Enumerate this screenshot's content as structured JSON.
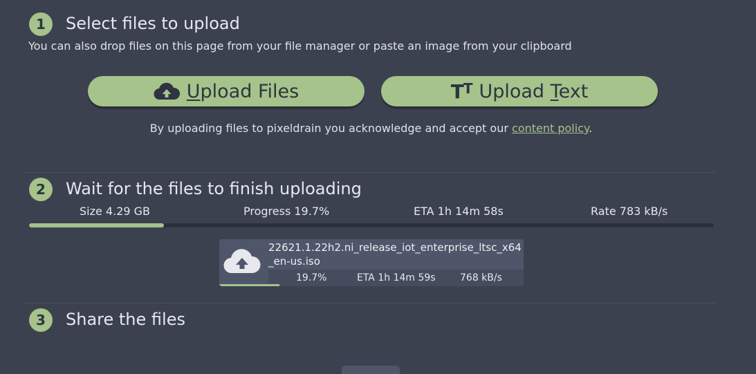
{
  "colors": {
    "background": "#3c4150",
    "accent": "#a5c38a",
    "card": "#4f5669",
    "track": "#2b303c"
  },
  "step1": {
    "number": "1",
    "title": "Select files to upload",
    "subtitle": "You can also drop files on this page from your file manager or paste an image from your clipboard",
    "upload_files": {
      "icon": "cloud-upload-icon",
      "mnemonic": "U",
      "label_rest": "pload Files"
    },
    "upload_text": {
      "icon": "text-size-icon",
      "label_start": "Upload ",
      "mnemonic": "T",
      "label_rest": "ext"
    },
    "policy_prefix": "By uploading files to pixeldrain you acknowledge and accept our ",
    "policy_link": "content policy",
    "policy_suffix": "."
  },
  "step2": {
    "number": "2",
    "title": "Wait for the files to finish uploading",
    "stats": {
      "size": "Size 4.29 GB",
      "progress": "Progress 19.7%",
      "eta": "ETA 1h 14m 58s",
      "rate": "Rate 783 kB/s"
    },
    "overall_progress": 0.197,
    "file": {
      "icon": "cloud-upload-icon",
      "name": "22621.1.22h2.ni_release_iot_enterprise_ltsc_x64_en-us.iso",
      "progress_text": "19.7%",
      "eta": "ETA 1h 14m 59s",
      "rate": "768 kB/s",
      "progress": 0.197
    }
  },
  "step3": {
    "number": "3",
    "title": "Share the files"
  }
}
